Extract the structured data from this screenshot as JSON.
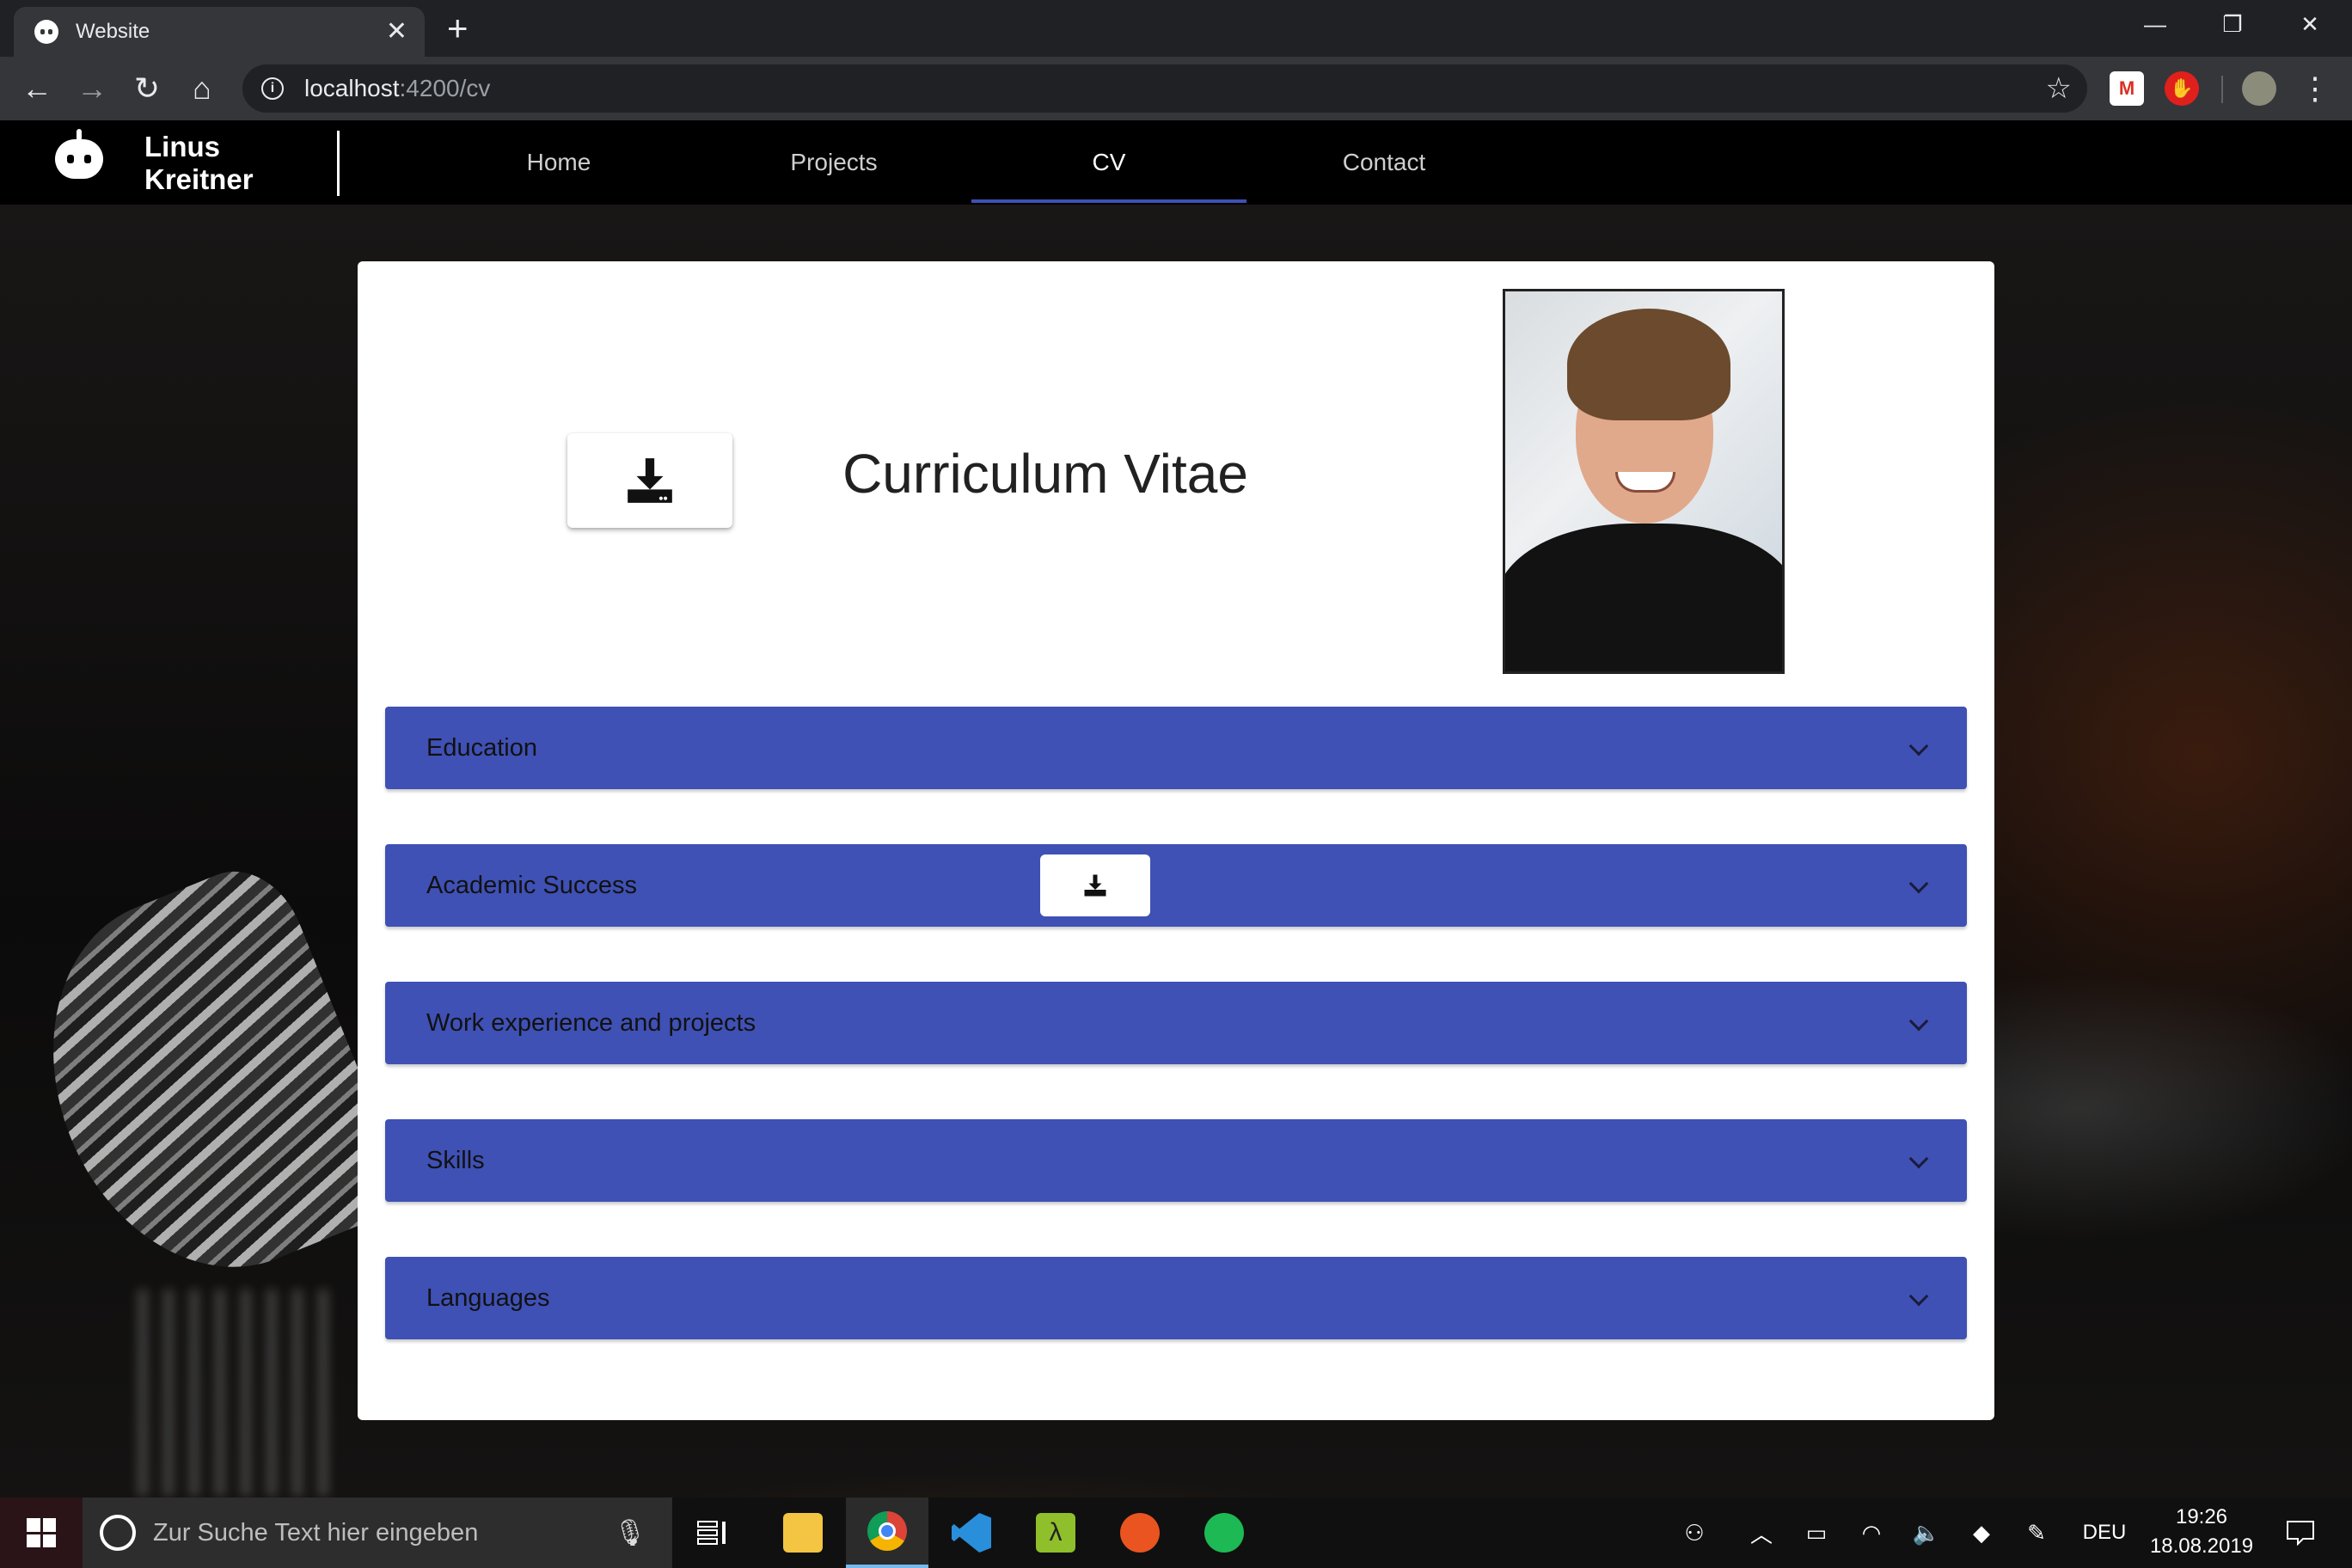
{
  "browser": {
    "tab_title": "Website",
    "tab_close": "✕",
    "new_tab": "+",
    "window_controls": {
      "minimize": "—",
      "restore": "❐",
      "close": "✕"
    },
    "url_host": "localhost",
    "url_path": ":4200/cv",
    "info_glyph": "i",
    "back": "←",
    "forward": "→",
    "reload": "↻",
    "home": "⌂",
    "star": "☆",
    "menu": "⋮",
    "extensions": [
      {
        "name": "gmail-extension-icon",
        "color": "#d93025",
        "glyph": "M"
      },
      {
        "name": "adblock-extension-icon",
        "color": "#e0201d",
        "glyph": "✋"
      },
      {
        "name": "profile-avatar-icon",
        "color": "#8c8c7a",
        "glyph": ""
      }
    ]
  },
  "site": {
    "brand_line1": "Linus",
    "brand_line2": "Kreitner",
    "nav": [
      {
        "label": "Home",
        "active": false
      },
      {
        "label": "Projects",
        "active": false
      },
      {
        "label": "CV",
        "active": true
      },
      {
        "label": "Contact",
        "active": false
      }
    ],
    "accent_color": "#3f51b5"
  },
  "cv": {
    "title": "Curriculum Vitae",
    "sections": [
      {
        "title": "Education",
        "has_download": false
      },
      {
        "title": "Academic Success",
        "has_download": true
      },
      {
        "title": "Work experience and projects",
        "has_download": false
      },
      {
        "title": "Skills",
        "has_download": false
      },
      {
        "title": "Languages",
        "has_download": false
      }
    ]
  },
  "taskbar": {
    "search_placeholder": "Zur Suche Text hier eingeben",
    "apps": [
      {
        "name": "task-view-icon",
        "color": ""
      },
      {
        "name": "file-explorer-icon",
        "color": "#f4c542"
      },
      {
        "name": "chrome-icon",
        "color": "#4285f4",
        "active": true
      },
      {
        "name": "vscode-icon",
        "color": "#2a8fdb"
      },
      {
        "name": "lambda-app-icon",
        "color": "#8fbf2a"
      },
      {
        "name": "ubuntu-icon",
        "color": "#e95420"
      },
      {
        "name": "spotify-icon",
        "color": "#1db954"
      }
    ],
    "language": "DEU",
    "time": "19:26",
    "date": "18.08.2019"
  }
}
